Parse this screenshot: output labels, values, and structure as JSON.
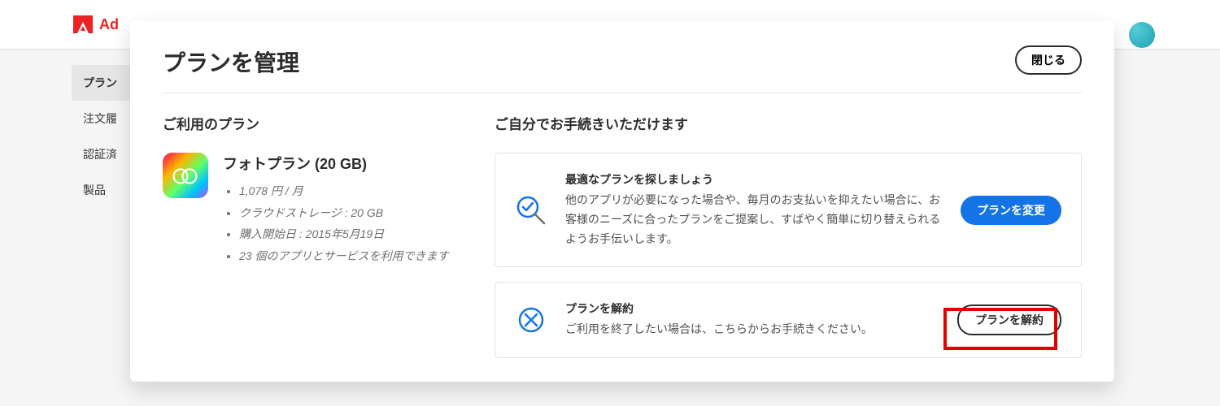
{
  "header": {
    "brand": "Ad"
  },
  "sidebar": {
    "items": [
      "プラン",
      "注文履",
      "認証済",
      "製品"
    ]
  },
  "modal": {
    "title": "プランを管理",
    "close": "閉じる",
    "left": {
      "heading": "ご利用のプラン",
      "plan_name": "フォトプラン (20 GB)",
      "meta": [
        "1,078 円 / 月",
        "クラウドストレージ : 20 GB",
        "購入開始日 : 2015年5月19日",
        "23 個のアプリとサービスを利用できます"
      ]
    },
    "right": {
      "heading": "ご自分でお手続きいただけます",
      "cards": [
        {
          "title": "最適なプランを探しましょう",
          "desc": "他のアプリが必要になった場合や、毎月のお支払いを抑えたい場合に、お客様のニーズに合ったプランをご提案し、すばやく簡単に切り替えられるようお手伝いします。",
          "button": "プランを変更"
        },
        {
          "title": "プランを解約",
          "desc": "ご利用を終了したい場合は、こちらからお手続きください。",
          "button": "プランを解約"
        }
      ]
    }
  }
}
